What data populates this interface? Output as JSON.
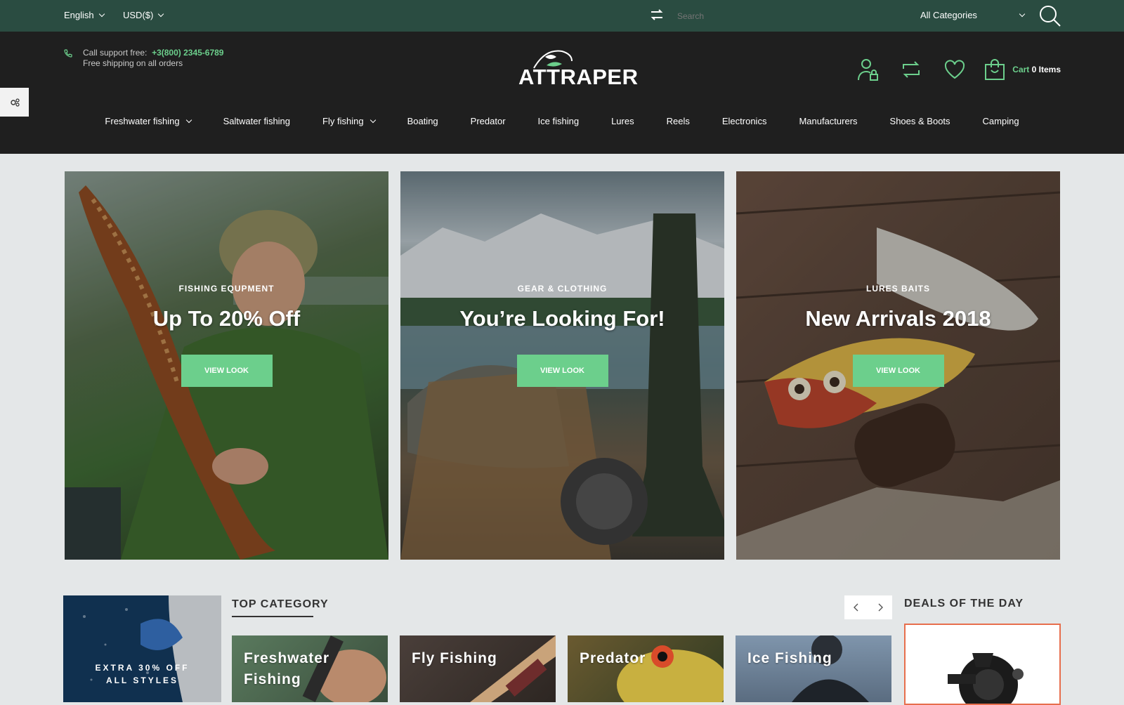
{
  "topbar": {
    "language": "English",
    "currency": "USD($)",
    "search_placeholder": "Search",
    "category_select": "All Categories"
  },
  "header": {
    "support_label": "Call support free:",
    "support_phone": "+3(800) 2345-6789",
    "shipping_note": "Free shipping on all orders",
    "logo_text": "ATTRAPER",
    "cart_label": "Cart",
    "cart_items": "0 Items"
  },
  "nav": {
    "items": [
      {
        "label": "Freshwater fishing"
      },
      {
        "label": "Saltwater fishing"
      },
      {
        "label": "Fly fishing"
      },
      {
        "label": "Boating"
      },
      {
        "label": "Predator"
      },
      {
        "label": "Ice fishing"
      },
      {
        "label": "Lures"
      },
      {
        "label": "Reels"
      },
      {
        "label": "Electronics"
      },
      {
        "label": "Manufacturers"
      },
      {
        "label": "Shoes & Boots"
      },
      {
        "label": "Camping"
      }
    ]
  },
  "banners": [
    {
      "kicker": "FISHING EQUPMENT",
      "title": "Up To 20% Off",
      "button": "VIEW LOOK"
    },
    {
      "kicker": "GEAR & CLOTHING",
      "title": "You’re Looking For!",
      "button": "VIEW LOOK"
    },
    {
      "kicker": "LURES BAITS",
      "title": "New Arrivals 2018",
      "button": "VIEW LOOK"
    }
  ],
  "promo": {
    "line1": "EXTRA 30% OFF",
    "line2": "ALL STYLES"
  },
  "top_category": {
    "title": "TOP CATEGORY",
    "items": [
      {
        "line1": "Freshwater",
        "line2": "Fishing"
      },
      {
        "line1": "Fly Fishing",
        "line2": ""
      },
      {
        "line1": "Predator",
        "line2": ""
      },
      {
        "line1": "Ice Fishing",
        "line2": ""
      }
    ]
  },
  "deals": {
    "title": "DEALS OF THE DAY"
  },
  "colors": {
    "accent": "#6ccf8c",
    "topbar": "#2a4c41",
    "header": "#1f1f1f",
    "deal_border": "#e76e4c"
  }
}
